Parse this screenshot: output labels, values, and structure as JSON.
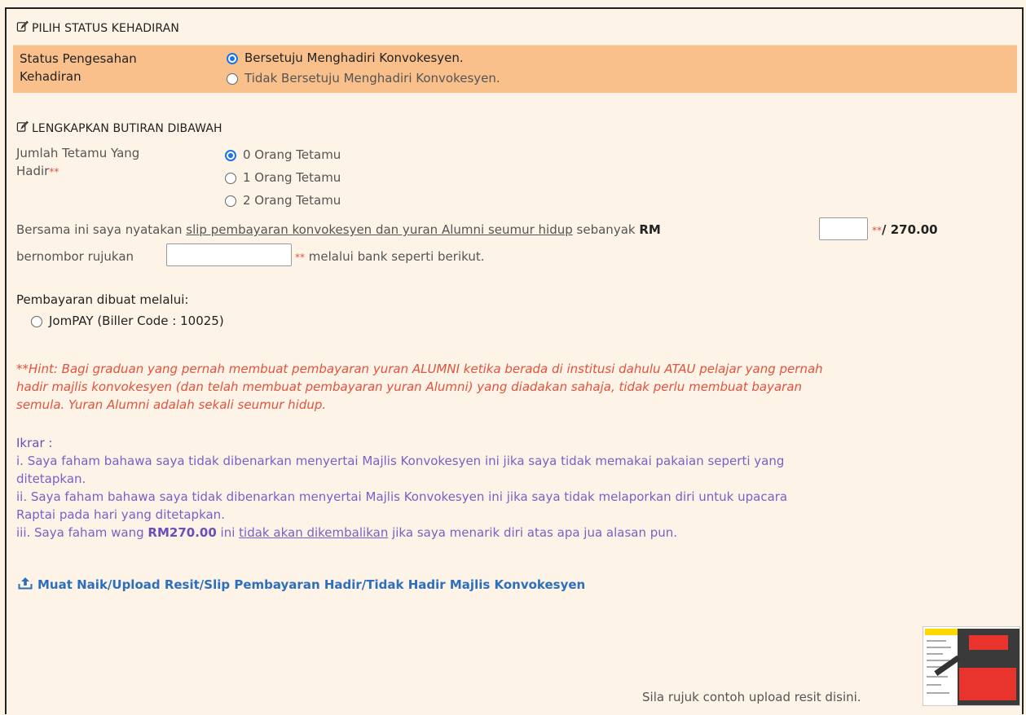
{
  "section1": {
    "title": "PILIH STATUS KEHADIRAN",
    "label_line1": "Status Pengesahan",
    "label_line2": "Kehadiran",
    "options": [
      {
        "label": "Bersetuju Menghadiri Konvokesyen.",
        "checked": true
      },
      {
        "label": "Tidak Bersetuju Menghadiri Konvokesyen.",
        "checked": false
      }
    ]
  },
  "section2": {
    "title": "LENGKAPKAN BUTIRAN DIBAWAH",
    "guest_label_line1": "Jumlah Tetamu Yang",
    "guest_label_line2": "Hadir",
    "required_mark": "**",
    "guest_options": [
      {
        "label": "0 Orang Tetamu",
        "checked": true
      },
      {
        "label": "1 Orang Tetamu",
        "checked": false
      },
      {
        "label": "2 Orang Tetamu",
        "checked": false
      }
    ]
  },
  "payment_statement": {
    "part1": "Bersama ini saya nyatakan ",
    "link": "slip pembayaran konvokesyen dan yuran Alumni seumur hidup",
    "part2": " sebanyak ",
    "rm": "RM",
    "amount_value": "",
    "amount_suffix_mark": "**",
    "amount_suffix": "/ 270.00",
    "ref_label": "bernombor rujukan",
    "ref_value": "",
    "ref_mark": "**",
    "ref_suffix": " melalui bank seperti berikut."
  },
  "payment_method": {
    "heading": "Pembayaran dibuat melalui:",
    "options": [
      {
        "label": "JomPAY (Biller Code : 10025)",
        "checked": false
      }
    ]
  },
  "hint": {
    "lines": [
      "**Hint: Bagi graduan yang pernah membuat pembayaran yuran ALUMNI ketika berada di institusi dahulu ATAU pelajar yang pernah",
      "hadir majlis konvokesyen (dan telah membuat pembayaran yuran Alumni) yang diadakan sahaja, tidak perlu membuat bayaran",
      "semula. Yuran Alumni adalah sekali seumur hidup."
    ]
  },
  "ikrar": {
    "title": "Ikrar :",
    "line1": "i. Saya faham bahawa saya tidak dibenarkan menyertai Majlis Konvokesyen ini jika saya tidak memakai pakaian seperti yang",
    "line2": "ditetapkan.",
    "line3": "ii. Saya faham bahawa saya tidak dibenarkan menyertai Majlis Konvokesyen ini jika saya tidak melaporkan diri untuk upacara",
    "line4": "Raptai pada hari yang ditetapkan.",
    "line5_pre": "iii. Saya faham wang ",
    "line5_amount": "RM270.00",
    "line5_mid": " ini ",
    "line5_link": "tidak akan dikembalikan",
    "line5_post": " jika saya menarik diri atas apa jua alasan pun."
  },
  "upload": {
    "label": "Muat Naik/Upload Resit/Slip Pembayaran Hadir/Tidak Hadir Majlis Konvokesyen"
  },
  "example": {
    "label": "Sila rujuk contoh upload resit disini."
  },
  "colors": {
    "status_row_bg": "#f9c08b",
    "page_bg": "#fdf3e6",
    "hint": "#e0533e",
    "ikrar": "#7b5fc7",
    "link": "#2c6fbf",
    "radio_checked": "#1a73e8"
  }
}
